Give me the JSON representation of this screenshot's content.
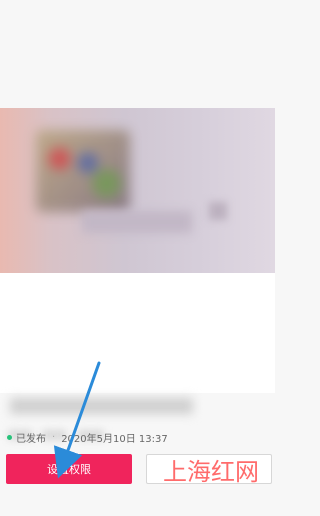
{
  "screen": {
    "status_label": "已发布",
    "timestamp": "2020年5月10日 13:37",
    "colors": {
      "primary_button": "#f0245c",
      "status_dot": "#27c27a",
      "arrow": "#2b8bd9",
      "watermark": "#ff4b4b"
    }
  },
  "actions": {
    "primary_label": "设置权限"
  },
  "watermark": {
    "text": "上海红网"
  },
  "icons": {
    "annotation": "arrow-icon",
    "status": "published-dot-icon"
  }
}
